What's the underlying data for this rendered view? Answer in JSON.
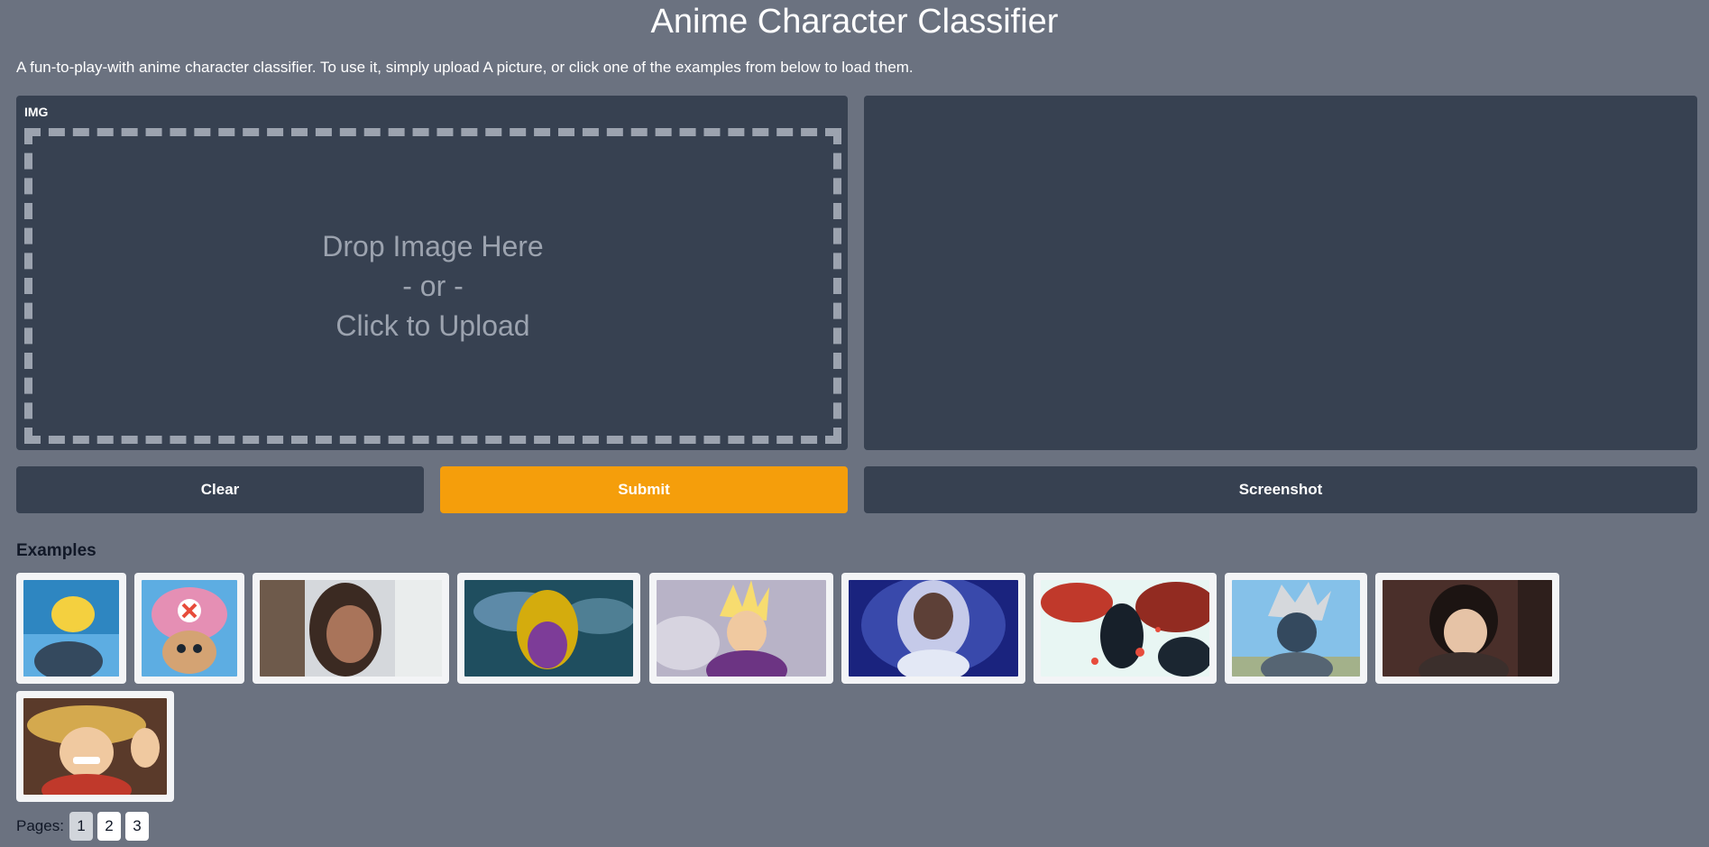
{
  "app": {
    "title": "Anime Character Classifier",
    "description": "A fun-to-play-with anime character classifier. To use it, simply upload A picture, or click one of the examples from below to load them."
  },
  "input": {
    "label": "IMG",
    "drop_line1": "Drop Image Here",
    "drop_line2": "- or -",
    "drop_line3": "Click to Upload"
  },
  "buttons": {
    "clear": "Clear",
    "submit": "Submit",
    "screenshot": "Screenshot"
  },
  "examples": {
    "label": "Examples",
    "items": [
      {
        "subject": "blonde anime character by the sea"
      },
      {
        "subject": "Chopper with pink hat"
      },
      {
        "subject": "dark-haired character by window"
      },
      {
        "subject": "Golden Frieza"
      },
      {
        "subject": "Super Saiyan Gohan"
      },
      {
        "subject": "Ultra Instinct Goku"
      },
      {
        "subject": "Itachi with red leaves"
      },
      {
        "subject": "Kakashi"
      },
      {
        "subject": "Levi"
      },
      {
        "subject": "Luffy waving"
      }
    ]
  },
  "pagination": {
    "label": "Pages:",
    "pages": [
      "1",
      "2",
      "3"
    ],
    "current": "1"
  },
  "colors": {
    "background": "#6b7280",
    "panel": "#374151",
    "accent": "#f59e0b"
  }
}
